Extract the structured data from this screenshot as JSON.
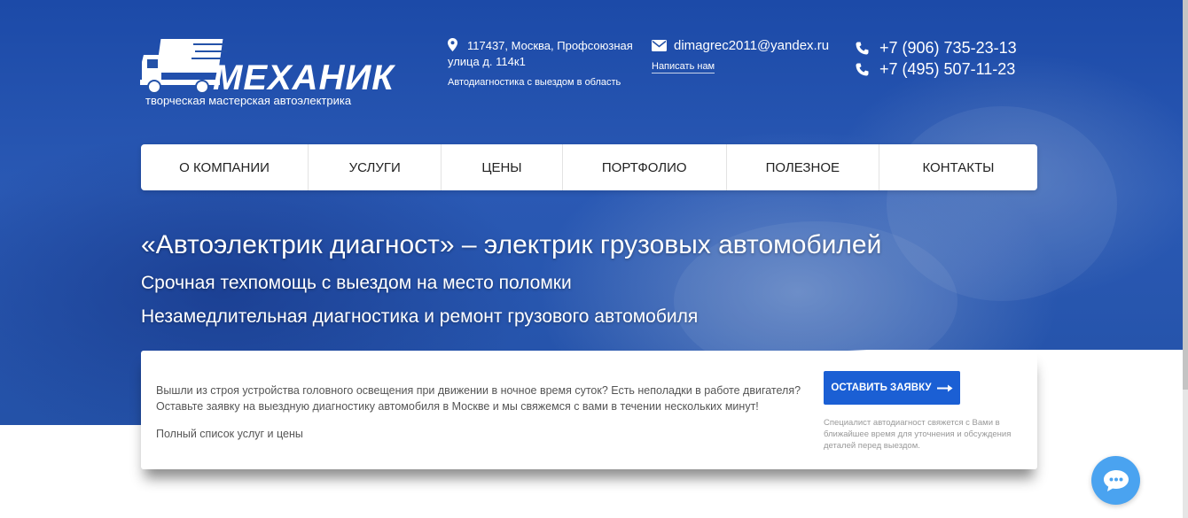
{
  "logo": {
    "name": "МЕХАНИК",
    "tagline": "творческая мастерская автоэлектрика",
    "icon": "truck-icon"
  },
  "header": {
    "address_line1": "117437, Москва, Профсоюзная",
    "address_line2": "улица д. 114к1",
    "address_note": "Автодиагностика с выездом в область",
    "email": "dimagrec2011@yandex.ru",
    "email_link": "Написать нам",
    "phones": [
      "+7 (906) 735-23-13",
      "+7 (495) 507-11-23"
    ]
  },
  "nav": {
    "items": [
      {
        "label": "О КОМПАНИИ"
      },
      {
        "label": "УСЛУГИ"
      },
      {
        "label": "ЦЕНЫ"
      },
      {
        "label": "ПОРТФОЛИО"
      },
      {
        "label": "ПОЛЕЗНОЕ"
      },
      {
        "label": "КОНТАКТЫ"
      }
    ]
  },
  "hero": {
    "title": "«Автоэлектрик диагност» – электрик грузовых автомобилей",
    "subtitle1": "Срочная техпомощь с выездом на место поломки",
    "subtitle2": "Незамедлительная диагностика и ремонт грузового автомобиля"
  },
  "card": {
    "text_line1": "Вышли из строя устройства головного освещения при движении в ночное время суток? Есть неполадки в работе двигателя?",
    "text_line2": "Оставьте заявку на выездную диагностику автомобиля в Москве и мы свяжемся с вами в течении нескольких минут!",
    "services_link": "Полный список услуг и цены",
    "cta_label": "ОСТАВИТЬ ЗАЯВКУ",
    "cta_note": "Специалист автодиагност свяжется с Вами в ближайшее время для уточнения и обсуждения деталей перед выездом."
  },
  "colors": {
    "hero_blue": "#2452a8",
    "accent": "#1b5fd4",
    "chat": "#4aa3f0"
  }
}
